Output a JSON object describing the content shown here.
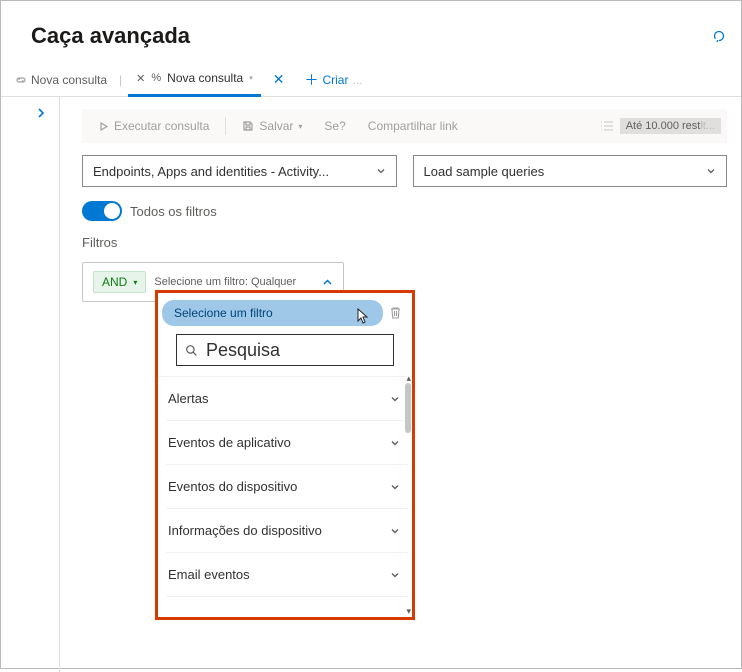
{
  "header": {
    "title": "Caça avançada"
  },
  "tabs": {
    "static_label": "Nova consulta",
    "active_label": "Nova consulta",
    "close_symbol": "✕",
    "new_label_prefix": "Criar",
    "new_label_suffix": "..."
  },
  "toolbar": {
    "run": "Executar consulta",
    "save": "Salvar",
    "then": "Se?",
    "share": "Compartilhar link",
    "limit": "Até 10.000 rest",
    "limit_dim": "lt..."
  },
  "selects": {
    "scope": "Endpoints, Apps and identities - Activity...",
    "sample": "Load sample queries"
  },
  "toggle": {
    "label": "Todos os filtros"
  },
  "section": {
    "filters_label": "Filtros"
  },
  "filterbox": {
    "and": "AND",
    "hint": "Selecione um filtro: Qualquer"
  },
  "dropdown": {
    "pill": "Selecione um filtro",
    "search_placeholder": "Pesquisa",
    "options": [
      "Alertas",
      "Eventos de aplicativo",
      "Eventos do dispositivo",
      "Informações do dispositivo",
      "Email eventos"
    ]
  }
}
